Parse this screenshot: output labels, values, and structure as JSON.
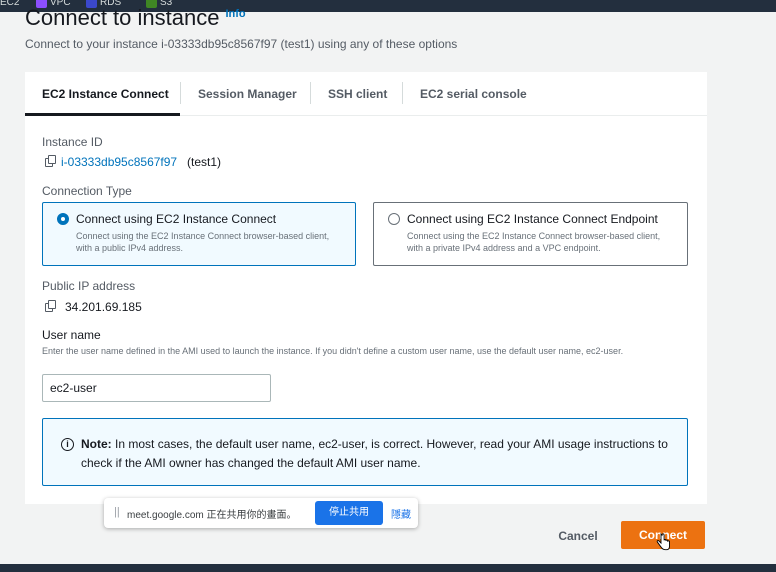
{
  "service_bar": [
    {
      "label": "EC2",
      "icon": "ec2-icon",
      "color": "#ec7211"
    },
    {
      "label": "VPC",
      "icon": "vpc-icon",
      "color": "#8c4fff"
    },
    {
      "label": "RDS",
      "icon": "rds-icon",
      "color": "#3b48cc"
    },
    {
      "label": "S3",
      "icon": "s3-icon",
      "color": "#3f8624"
    }
  ],
  "header": {
    "title": "Connect to instance",
    "info_link": "Info",
    "subtitle": "Connect to your instance i-03333db95c8567f97 (test1) using any of these options"
  },
  "tabs": [
    {
      "label": "EC2 Instance Connect",
      "active": true
    },
    {
      "label": "Session Manager",
      "active": false
    },
    {
      "label": "SSH client",
      "active": false
    },
    {
      "label": "EC2 serial console",
      "active": false
    }
  ],
  "instance": {
    "label": "Instance ID",
    "id_link": "i-03333db95c8567f97",
    "name_suffix": "(test1)"
  },
  "connection_type": {
    "label": "Connection Type",
    "options": [
      {
        "title": "Connect using EC2 Instance Connect",
        "description": "Connect using the EC2 Instance Connect browser-based client, with a public IPv4 address.",
        "selected": true
      },
      {
        "title": "Connect using EC2 Instance Connect Endpoint",
        "description": "Connect using the EC2 Instance Connect browser-based client, with a private IPv4 address and a VPC endpoint.",
        "selected": false
      }
    ]
  },
  "public_ip": {
    "label": "Public IP address",
    "value": "34.201.69.185"
  },
  "username": {
    "label": "User name",
    "hint": "Enter the user name defined in the AMI used to launch the instance. If you didn't define a custom user name, use the default user name, ec2-user.",
    "value": "ec2-user"
  },
  "note": {
    "prefix": "Note:",
    "text": "In most cases, the default user name, ec2-user, is correct. However, read your AMI usage instructions to check if the AMI owner has changed the default AMI user name."
  },
  "screen_share": {
    "message": "meet.google.com 正在共用你的畫面。",
    "stop_label": "停止共用",
    "hide_label": "隱藏"
  },
  "footer": {
    "cancel_label": "Cancel",
    "connect_label": "Connect"
  }
}
